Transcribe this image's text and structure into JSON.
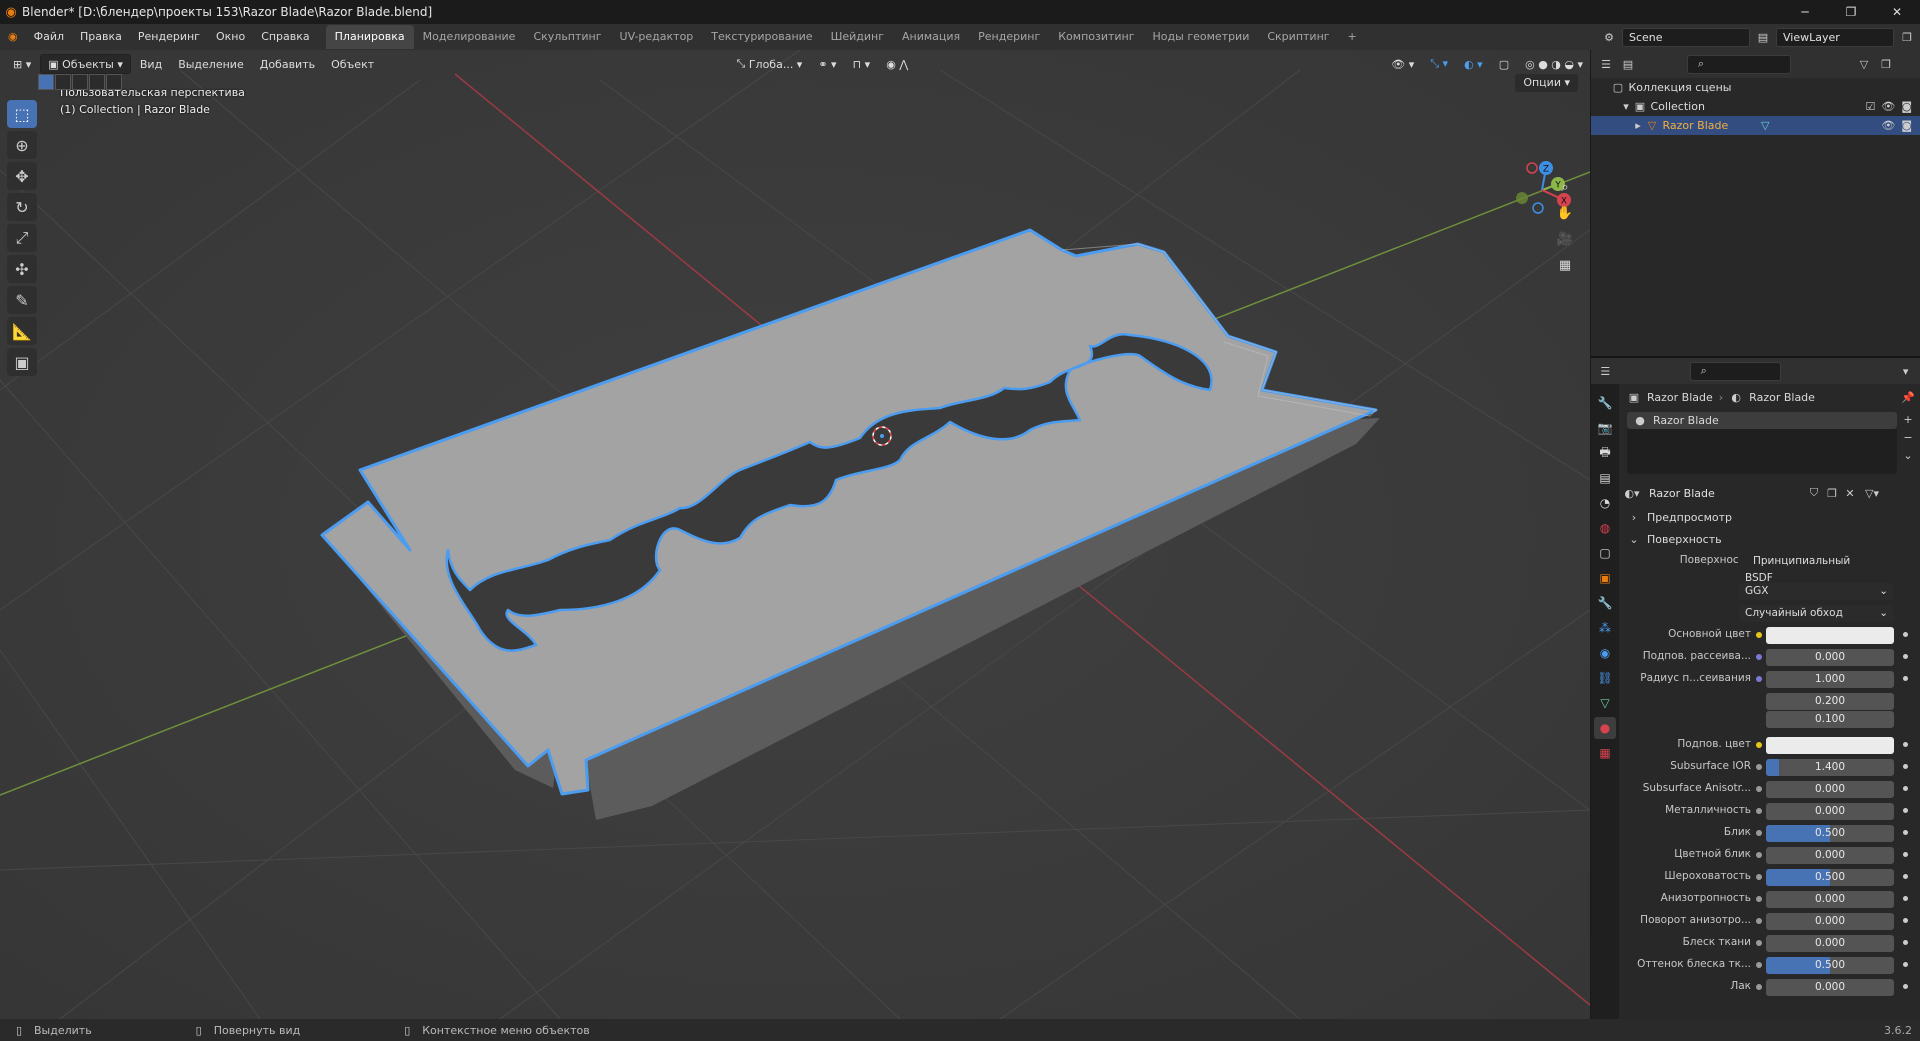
{
  "window": {
    "title": "Blender* [D:\\блендер\\проекты 153\\Razor Blade\\Razor Blade.blend]",
    "minimize": "─",
    "maximize": "❐",
    "close": "✕"
  },
  "menu": {
    "items": [
      "Файл",
      "Правка",
      "Рендеринг",
      "Окно",
      "Справка"
    ]
  },
  "workspaces": [
    "Планировка",
    "Моделирование",
    "Скульптинг",
    "UV-редактор",
    "Текстурирование",
    "Шейдинг",
    "Анимация",
    "Рендеринг",
    "Композитинг",
    "Ноды геометрии",
    "Скриптинг"
  ],
  "workspace_add": "+",
  "scene": {
    "name": "Scene",
    "view_layer": "ViewLayer"
  },
  "viewport_header": {
    "mode": "Объекты",
    "menus": [
      "Вид",
      "Выделение",
      "Добавить",
      "Объект"
    ],
    "transform_orientation": "Глоба...",
    "options": "Опции"
  },
  "viewport_overlay": {
    "line1": "Пользовательская перспектива",
    "line2": "(1) Collection | Razor Blade"
  },
  "gizmo": {
    "x": "X",
    "y": "Y",
    "z": "Z"
  },
  "outliner": {
    "root": "Коллекция сцены",
    "collection": "Collection",
    "object": "Razor Blade"
  },
  "properties": {
    "breadcrumb_object": "Razor Blade",
    "breadcrumb_material": "Razor Blade",
    "slot_name": "Razor Blade",
    "material_name": "Razor Blade",
    "sections": {
      "preview": "Предпросмотр",
      "surface": "Поверхность"
    },
    "surface_label": "Поверхность",
    "surface_value": "Принципиальный BSDF",
    "distribution": "GGX",
    "subsurface_method": "Случайный обход",
    "rows": [
      {
        "label": "Основной цвет",
        "type": "color",
        "color": "#ebebeb",
        "dot": "#e6c619"
      },
      {
        "label": "Подпов. рассеива...",
        "type": "value",
        "value": "0.000",
        "fill": 0,
        "dot": "#7a7ad6"
      },
      {
        "label": "Радиус п...сеивания",
        "type": "value",
        "value": "1.000",
        "fill": 0,
        "dot": "#7a7ad6"
      },
      {
        "label": "",
        "type": "value",
        "value": "0.200",
        "fill": 0
      },
      {
        "label": "",
        "type": "value",
        "value": "0.100",
        "fill": 0
      },
      {
        "label": "Подпов. цвет",
        "type": "color",
        "color": "#ebebeb",
        "dot": "#e6c619"
      },
      {
        "label": "Subsurface IOR",
        "type": "value",
        "value": "1.400",
        "fill": 0.1,
        "dot": "#9a9a9a"
      },
      {
        "label": "Subsurface Anisotr...",
        "type": "value",
        "value": "0.000",
        "fill": 0,
        "dot": "#9a9a9a"
      },
      {
        "label": "Металличность",
        "type": "value",
        "value": "0.000",
        "fill": 0,
        "dot": "#9a9a9a"
      },
      {
        "label": "Блик",
        "type": "value",
        "value": "0.500",
        "fill": 0.5,
        "dot": "#9a9a9a"
      },
      {
        "label": "Цветной блик",
        "type": "value",
        "value": "0.000",
        "fill": 0,
        "dot": "#9a9a9a"
      },
      {
        "label": "Шероховатость",
        "type": "value",
        "value": "0.500",
        "fill": 0.5,
        "dot": "#9a9a9a"
      },
      {
        "label": "Анизотропность",
        "type": "value",
        "value": "0.000",
        "fill": 0,
        "dot": "#9a9a9a"
      },
      {
        "label": "Поворот анизотро...",
        "type": "value",
        "value": "0.000",
        "fill": 0,
        "dot": "#9a9a9a"
      },
      {
        "label": "Блеск ткани",
        "type": "value",
        "value": "0.000",
        "fill": 0,
        "dot": "#9a9a9a"
      },
      {
        "label": "Оттенок блеска тк...",
        "type": "value",
        "value": "0.500",
        "fill": 0.5,
        "dot": "#9a9a9a"
      },
      {
        "label": "Лак",
        "type": "value",
        "value": "0.000",
        "fill": 0,
        "dot": "#9a9a9a"
      }
    ]
  },
  "statusbar": {
    "select": "Выделить",
    "rotate": "Повернуть вид",
    "context": "Контекстное меню объектов",
    "version": "3.6.2"
  },
  "colors": {
    "accent": "#4772b3",
    "x_axis": "#d6434f",
    "y_axis": "#8cb84a",
    "z_axis": "#3d8fe6",
    "blade": "#a0a0a0",
    "outline": "#4c9cf0"
  }
}
